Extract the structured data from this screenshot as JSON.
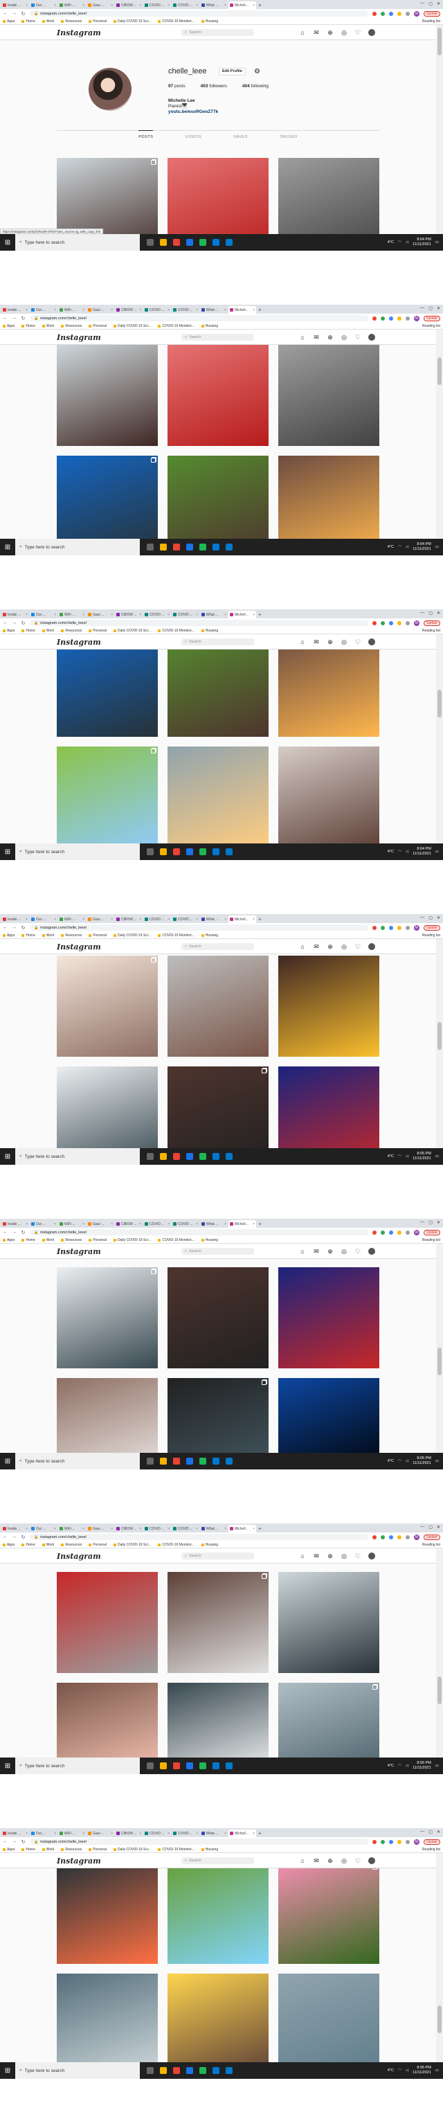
{
  "browser": {
    "tabs": [
      {
        "label": "Inside ...",
        "color": "#e53935"
      },
      {
        "label": "Our ...",
        "color": "#1e88e5"
      },
      {
        "label": "WiFi ...",
        "color": "#43a047"
      },
      {
        "label": "Gaur ...",
        "color": "#fb8c00"
      },
      {
        "label": "CIBOW ...",
        "color": "#8e24aa"
      },
      {
        "label": "COVID ...",
        "color": "#00897b"
      },
      {
        "label": "COVID ...",
        "color": "#00897b"
      },
      {
        "label": "What ...",
        "color": "#3949ab"
      },
      {
        "label": "Michell...",
        "color": "#c13584"
      }
    ],
    "new_tab": "+",
    "url": "instagram.com/chelle_leee/",
    "update_label": "Update",
    "profile_initial": "M",
    "bookmarks": [
      "Apps",
      "Home",
      "Work",
      "Resources",
      "Personal",
      "Daily COVID-19 Scr...",
      "COVID-19 Monitori...",
      "Housing"
    ],
    "reading_list": "Reading list"
  },
  "instagram": {
    "logo": "Instagram",
    "search_placeholder": "Search"
  },
  "profile": {
    "username": "chelle_leee",
    "edit_label": "Edit Profile",
    "posts": "97",
    "posts_label": "posts",
    "followers": "403",
    "followers_label": "followers",
    "following": "404",
    "following_label": "following",
    "name": "Michelle Lee",
    "bio_line": "Pianist🎹",
    "link": "youtu.be/esoRGeoZ77k",
    "tabs": [
      "POSTS",
      "VIDEOS",
      "SAVED",
      "TAGGED"
    ]
  },
  "status_url": "https://instagram.com/p/CRwvlh-nF5X/?utm_source=ig_web_copy_link",
  "taskbar": {
    "search_placeholder": "Type here to search",
    "weather": "4°C",
    "frames_time": [
      "8:04 PM",
      "8:04 PM",
      "8:04 PM",
      "8:05 PM",
      "8:05 PM",
      "8:05 PM",
      "8:05 PM"
    ],
    "date": "11/11/2021"
  }
}
